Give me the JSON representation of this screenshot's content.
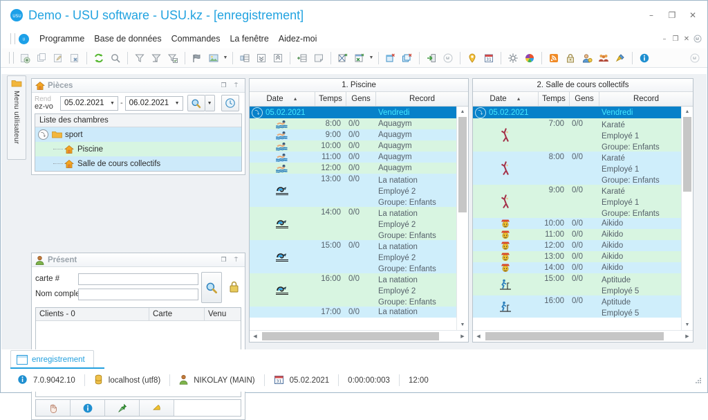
{
  "window": {
    "title": "Demo - USU software - USU.kz - [enregistrement]",
    "logo_icon": "usu-logo-icon",
    "controls": [
      {
        "name": "minimize-button",
        "glyph": "–"
      },
      {
        "name": "maximize-button",
        "glyph": "❐"
      },
      {
        "name": "close-button",
        "glyph": "✕"
      }
    ]
  },
  "menubar": {
    "logo_icon": "usu-logo-icon",
    "items": [
      {
        "name": "menu-programme",
        "label": "Programme"
      },
      {
        "name": "menu-base-de-donnees",
        "label": "Base de données"
      },
      {
        "name": "menu-commandes",
        "label": "Commandes"
      },
      {
        "name": "menu-la-fenetre",
        "label": "La fenêtre"
      },
      {
        "name": "menu-aidez-moi",
        "label": "Aidez-moi"
      }
    ],
    "mdi_controls": [
      {
        "name": "mdi-minimize-button",
        "glyph": "–"
      },
      {
        "name": "mdi-restore-button",
        "glyph": "❐"
      },
      {
        "name": "mdi-close-button",
        "glyph": "✕"
      },
      {
        "name": "mdi-more-button",
        "glyph": "⤵"
      }
    ]
  },
  "toolbar": {
    "groups": [
      [
        "add-record-icon",
        "copy-record-icon",
        "edit-record-icon",
        "delete-record-icon"
      ],
      [
        "refresh-icon",
        "search-icon"
      ],
      [
        "filter-icon",
        "filter-clear-icon",
        "filter-apply-icon"
      ],
      [
        "flag-icon",
        "image-icon"
      ],
      [
        "group-columns-icon",
        "expand-all-icon",
        "collapse-all-icon"
      ],
      [
        "insert-row-icon",
        "note-icon"
      ],
      [
        "export-word-icon",
        "export-excel-icon"
      ],
      [
        "report-new-icon",
        "report-copy-icon"
      ],
      [
        "exit-icon",
        "more-down-icon"
      ],
      [
        "location-icon",
        "calendar-icon"
      ],
      [
        "settings-icon",
        "palette-icon"
      ],
      [
        "rss-icon",
        "lock-icon",
        "user-icon",
        "users-icon",
        "plugin-icon"
      ],
      [
        "info-icon"
      ]
    ],
    "overflow_icon": "toolbar-overflow-icon"
  },
  "sidebar": {
    "folder_icon": "folder-icon",
    "label": "Menu utilisateur"
  },
  "pieces_panel": {
    "icon": "house-icon",
    "title": "Pièces",
    "tools": [
      {
        "name": "panel-restore-button",
        "glyph": "❐"
      },
      {
        "name": "panel-pin-button",
        "glyph": "⍑"
      }
    ],
    "date_filter": {
      "label_line1": "Rend",
      "label_line2": "ez-vo",
      "date_from": "05.02.2021",
      "date_to": "06.02.2021",
      "separator": "-",
      "search_icon": "search-icon",
      "dropdown_glyph": "▼",
      "clock_icon": "clock-icon"
    },
    "rooms": {
      "header": "Liste des chambres",
      "tree": [
        {
          "name": "tree-node-sport",
          "label": "sport",
          "level": 0,
          "icon": "folder-icon",
          "expander": "⤵"
        },
        {
          "name": "tree-node-piscine",
          "label": "Piscine",
          "level": 1,
          "icon": "house-icon"
        },
        {
          "name": "tree-node-salle",
          "label": "Salle de cours collectifs",
          "level": 1,
          "icon": "house-icon"
        }
      ]
    }
  },
  "present_panel": {
    "icon": "person-icon",
    "title": "Présent",
    "tools": [
      {
        "name": "panel-restore-button",
        "glyph": "❐"
      },
      {
        "name": "panel-pin-button",
        "glyph": "⍑"
      }
    ],
    "fields": [
      {
        "name": "carte-number-field",
        "label": "carte #",
        "value": "",
        "placeholder": ""
      },
      {
        "name": "nom-complet-field",
        "label": "Nom complet",
        "value": "",
        "placeholder": ""
      }
    ],
    "find_icon": "search-icon",
    "lock_icon": "lock-icon",
    "clients_grid": {
      "columns": [
        "Clients - 0",
        "Carte",
        "Venu"
      ],
      "rows": []
    },
    "actions": [
      {
        "name": "hand-button",
        "icon": "hand-icon"
      },
      {
        "name": "info-button",
        "icon": "info-icon"
      },
      {
        "name": "pin-button",
        "icon": "pin-icon"
      },
      {
        "name": "bell-button",
        "icon": "bell-icon"
      }
    ]
  },
  "grids": [
    {
      "name": "grid-piscine",
      "caption": "1. Piscine",
      "columns": [
        "Date",
        "Temps",
        "Gens",
        "Record"
      ],
      "sort_indicator": "▲",
      "group_row": {
        "date": "05.02.2021",
        "record": "Vendredi",
        "expander": "⤵"
      },
      "rows": [
        {
          "icon": "swimmer-icon",
          "time": "8:00",
          "people": "0/0",
          "record": "Aquagym",
          "employee": "",
          "group": "",
          "height": "single",
          "band": "green"
        },
        {
          "icon": "swimmer-icon",
          "time": "9:00",
          "people": "0/0",
          "record": "Aquagym",
          "employee": "",
          "group": "",
          "height": "single",
          "band": "blue"
        },
        {
          "icon": "swimmer-icon",
          "time": "10:00",
          "people": "0/0",
          "record": "Aquagym",
          "employee": "",
          "group": "",
          "height": "single",
          "band": "green"
        },
        {
          "icon": "swimmer-icon",
          "time": "11:00",
          "people": "0/0",
          "record": "Aquagym",
          "employee": "",
          "group": "",
          "height": "single",
          "band": "blue"
        },
        {
          "icon": "swimmer-icon",
          "time": "12:00",
          "people": "0/0",
          "record": "Aquagym",
          "employee": "",
          "group": "",
          "height": "single",
          "band": "green"
        },
        {
          "icon": "wave-icon",
          "time": "13:00",
          "people": "0/0",
          "record": "La natation",
          "employee": "Employé 2",
          "group": "Groupe: Enfants",
          "height": "multi",
          "band": "blue"
        },
        {
          "icon": "wave-icon",
          "time": "14:00",
          "people": "0/0",
          "record": "La natation",
          "employee": "Employé 2",
          "group": "Groupe: Enfants",
          "height": "multi",
          "band": "green"
        },
        {
          "icon": "wave-icon",
          "time": "15:00",
          "people": "0/0",
          "record": "La natation",
          "employee": "Employé 2",
          "group": "Groupe: Enfants",
          "height": "multi",
          "band": "blue"
        },
        {
          "icon": "wave-icon",
          "time": "16:00",
          "people": "0/0",
          "record": "La natation",
          "employee": "Employé 2",
          "group": "Groupe: Enfants",
          "height": "multi",
          "band": "green"
        },
        {
          "icon": "wave-icon",
          "time": "17:00",
          "people": "0/0",
          "record": "La natation",
          "employee": "",
          "group": "",
          "height": "single",
          "band": "blue"
        }
      ]
    },
    {
      "name": "grid-salle",
      "caption": "2. Salle de cours collectifs",
      "columns": [
        "Date",
        "Temps",
        "Gens",
        "Record"
      ],
      "sort_indicator": "▲",
      "group_row": {
        "date": "05.02.2021",
        "record": "Vendredi",
        "expander": "⤵"
      },
      "rows": [
        {
          "icon": "karate-icon",
          "time": "7:00",
          "people": "0/0",
          "record": "Karaté",
          "employee": "Employé 1",
          "group": "Groupe: Enfants",
          "height": "multi",
          "band": "green"
        },
        {
          "icon": "karate-icon",
          "time": "8:00",
          "people": "0/0",
          "record": "Karaté",
          "employee": "Employé 1",
          "group": "Groupe: Enfants",
          "height": "multi",
          "band": "blue"
        },
        {
          "icon": "karate-icon",
          "time": "9:00",
          "people": "0/0",
          "record": "Karaté",
          "employee": "Employé 1",
          "group": "Groupe: Enfants",
          "height": "multi",
          "band": "green"
        },
        {
          "icon": "aikido-icon",
          "time": "10:00",
          "people": "0/0",
          "record": "Aikido",
          "employee": "",
          "group": "",
          "height": "single",
          "band": "blue"
        },
        {
          "icon": "aikido-icon",
          "time": "11:00",
          "people": "0/0",
          "record": "Aikido",
          "employee": "",
          "group": "",
          "height": "single",
          "band": "green"
        },
        {
          "icon": "aikido-icon",
          "time": "12:00",
          "people": "0/0",
          "record": "Aikido",
          "employee": "",
          "group": "",
          "height": "single",
          "band": "blue"
        },
        {
          "icon": "aikido-icon",
          "time": "13:00",
          "people": "0/0",
          "record": "Aikido",
          "employee": "",
          "group": "",
          "height": "single",
          "band": "green"
        },
        {
          "icon": "aikido-icon",
          "time": "14:00",
          "people": "0/0",
          "record": "Aikido",
          "employee": "",
          "group": "",
          "height": "single",
          "band": "blue"
        },
        {
          "icon": "fitness-icon",
          "time": "15:00",
          "people": "0/0",
          "record": "Aptitude",
          "employee": "Employé 5",
          "group": "",
          "height": "double",
          "band": "green"
        },
        {
          "icon": "fitness-icon",
          "time": "16:00",
          "people": "0/0",
          "record": "Aptitude",
          "employee": "Employé 5",
          "group": "",
          "height": "double",
          "band": "blue"
        }
      ]
    }
  ],
  "doc_tab": {
    "name": "tab-enregistrement",
    "label": "enregistrement",
    "icon": "window-icon"
  },
  "statusbar": {
    "version": "7.0.9042.10",
    "database": "localhost (utf8)",
    "user": "NIKOLAY (MAIN)",
    "date": "05.02.2021",
    "elapsed": "0:00:00:003",
    "time": "12:00",
    "icons": {
      "info": "info-icon",
      "database": "database-icon",
      "user": "user-icon",
      "calendar": "calendar-icon",
      "grip": "resize-grip-icon"
    }
  },
  "colors": {
    "accent": "#23a0de",
    "selection": "#0781c9",
    "selection_text": "#45e8ff",
    "row_green": "#d8f5e1",
    "row_blue": "#cfeefb",
    "panel_title": "#9aa3ab"
  }
}
